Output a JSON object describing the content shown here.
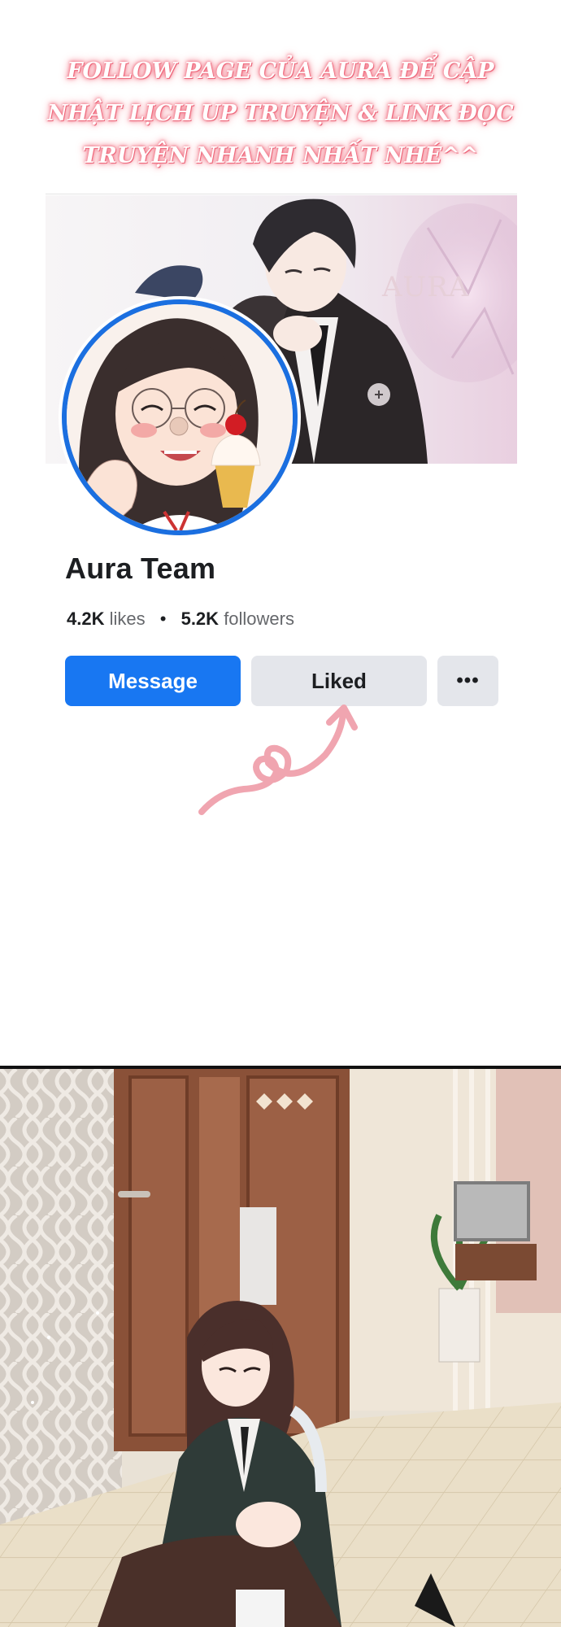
{
  "banner": {
    "line1": "FOLLOW PAGE CỦA AURA ĐỂ CẬP",
    "line2": "NHẬT LỊCH UP TRUYỆN  & LINK ĐỌC",
    "line3": "TRUYỆN NHANH NHẤT NHÉ^^"
  },
  "cover": {
    "watermark": "AURA"
  },
  "profile": {
    "name": "Aura Team",
    "likes_count": "4.2K",
    "likes_label": "likes",
    "separator": "•",
    "followers_count": "5.2K",
    "followers_label": "followers"
  },
  "actions": {
    "message_label": "Message",
    "liked_label": "Liked",
    "more_label": "•••"
  },
  "colors": {
    "banner_glow": "#f06b7e",
    "avatar_ring": "#1b6fe0",
    "primary_button": "#1877f2",
    "secondary_button": "#e4e6eb",
    "scribble": "#f0a5b0"
  },
  "icons": {
    "more": "more-dots-icon",
    "scribble": "heart-arrow-scribble-icon"
  }
}
